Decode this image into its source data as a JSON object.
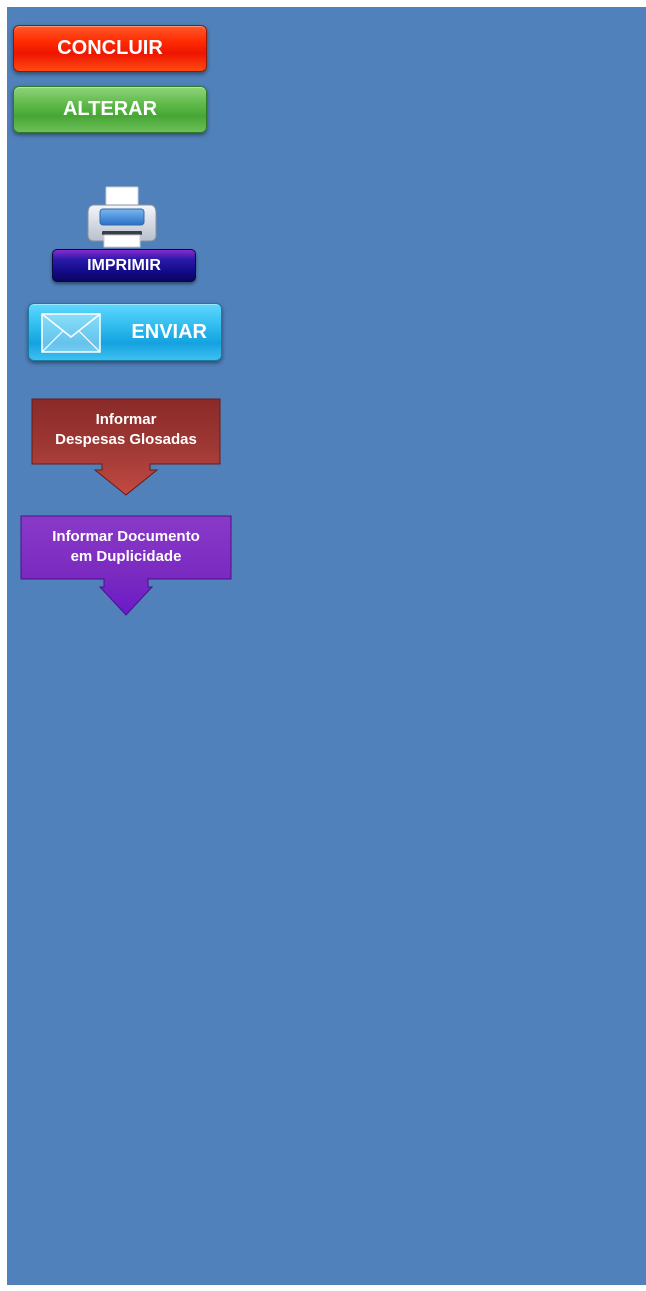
{
  "buttons": {
    "concluir": "CONCLUIR",
    "alterar": "ALTERAR",
    "imprimir": "IMPRIMIR",
    "enviar": "ENVIAR"
  },
  "actions": {
    "glosadas_line1": "Informar",
    "glosadas_line2": "Despesas Glosadas",
    "duplicidade_line1": "Informar Documento",
    "duplicidade_line2": "em Duplicidade"
  },
  "colors": {
    "background": "#5181bb",
    "concluir": "#ff2a00",
    "alterar": "#5cb847",
    "imprimir": "#120a88",
    "enviar": "#2ab8ec",
    "glosadas": "#9c3a36",
    "duplicidade": "#7a2ac0"
  },
  "icons": {
    "printer": "printer-icon",
    "envelope": "envelope-icon"
  }
}
